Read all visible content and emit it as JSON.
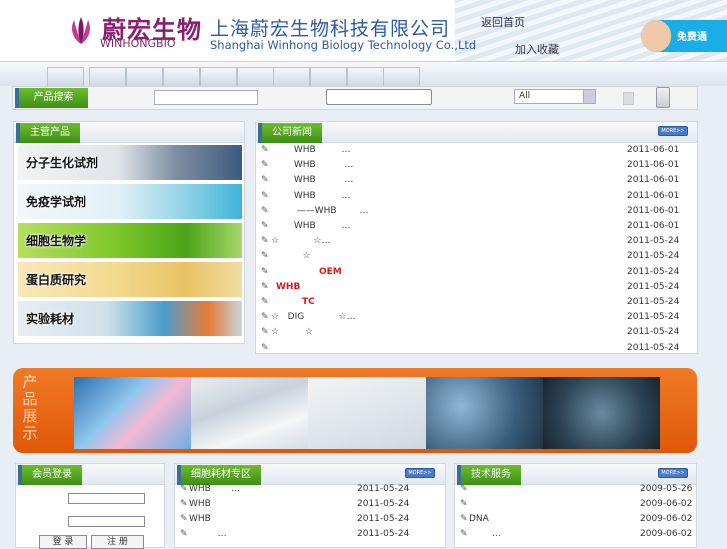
{
  "header": {
    "logo_cn": "蔚宏生物",
    "logo_en": "WINHONGBIO",
    "company_cn": "上海蔚宏生物科技有限公司",
    "company_en": "Shanghai Winhong Biology Technology Co.,Ltd",
    "link_home": "返回首页",
    "link_favorite": "加入收藏",
    "hotline": "免费通"
  },
  "search": {
    "title": "产品搜索",
    "select_value": "All"
  },
  "products": {
    "title": "主营产品",
    "categories": [
      "分子生化试剂",
      "免疫学试剂",
      "细胞生物学",
      "蛋白质研究",
      "实验耗材"
    ]
  },
  "news": {
    "title": "公司新闻",
    "more": "MORE>>",
    "items": [
      {
        "text": "        WHB         …",
        "date": "2011-06-01"
      },
      {
        "text": "        WHB          …",
        "date": "2011-06-01"
      },
      {
        "text": "        WHB          …",
        "date": "2011-06-01"
      },
      {
        "text": "        WHB         …",
        "date": "2011-06-01"
      },
      {
        "text": "         ——WHB        …",
        "date": "2011-06-01"
      },
      {
        "text": "        WHB         …",
        "date": "2011-06-01"
      },
      {
        "text": "☆            ☆…",
        "date": "2011-05-24"
      },
      {
        "text": "           ☆",
        "date": "2011-05-24"
      },
      {
        "text": "",
        "highlight": "OEM",
        "date": "2011-05-24"
      },
      {
        "text": "",
        "highlight": "WHB",
        "date": "2011-05-24"
      },
      {
        "text": "",
        "highlight": "TC",
        "date": "2011-05-24"
      },
      {
        "text": "☆   DIG            ☆…",
        "date": "2011-05-24"
      },
      {
        "text": "☆         ☆",
        "date": "2011-05-24"
      },
      {
        "text": "",
        "date": "2011-05-24"
      }
    ]
  },
  "showcase": {
    "title_vertical": "产品展示"
  },
  "login": {
    "title": "会员登录",
    "login_button": "登 录",
    "register_button": "注 册"
  },
  "consumables": {
    "title": "细胞耗材专区",
    "more": "MORE>>",
    "items": [
      {
        "text": "WHB       …",
        "date": "2011-05-24"
      },
      {
        "text": "WHB",
        "date": "2011-05-24"
      },
      {
        "text": "WHB",
        "date": "2011-05-24"
      },
      {
        "text": "          …",
        "date": "2011-05-24"
      }
    ]
  },
  "tech": {
    "title": "技术服务",
    "more": "MORE>>",
    "items": [
      {
        "text": "",
        "date": "2009-05-26"
      },
      {
        "text": "",
        "date": "2009-06-02"
      },
      {
        "text": "DNA",
        "date": "2009-06-02"
      },
      {
        "text": "        …",
        "date": "2009-06-02"
      }
    ]
  },
  "colors": {
    "green_tab": "#4fa31f",
    "brand_purple": "#8a1f6e",
    "brand_blue": "#2c5aa0",
    "showcase_orange": "#e96a18",
    "highlight_red": "#d61a1a"
  }
}
